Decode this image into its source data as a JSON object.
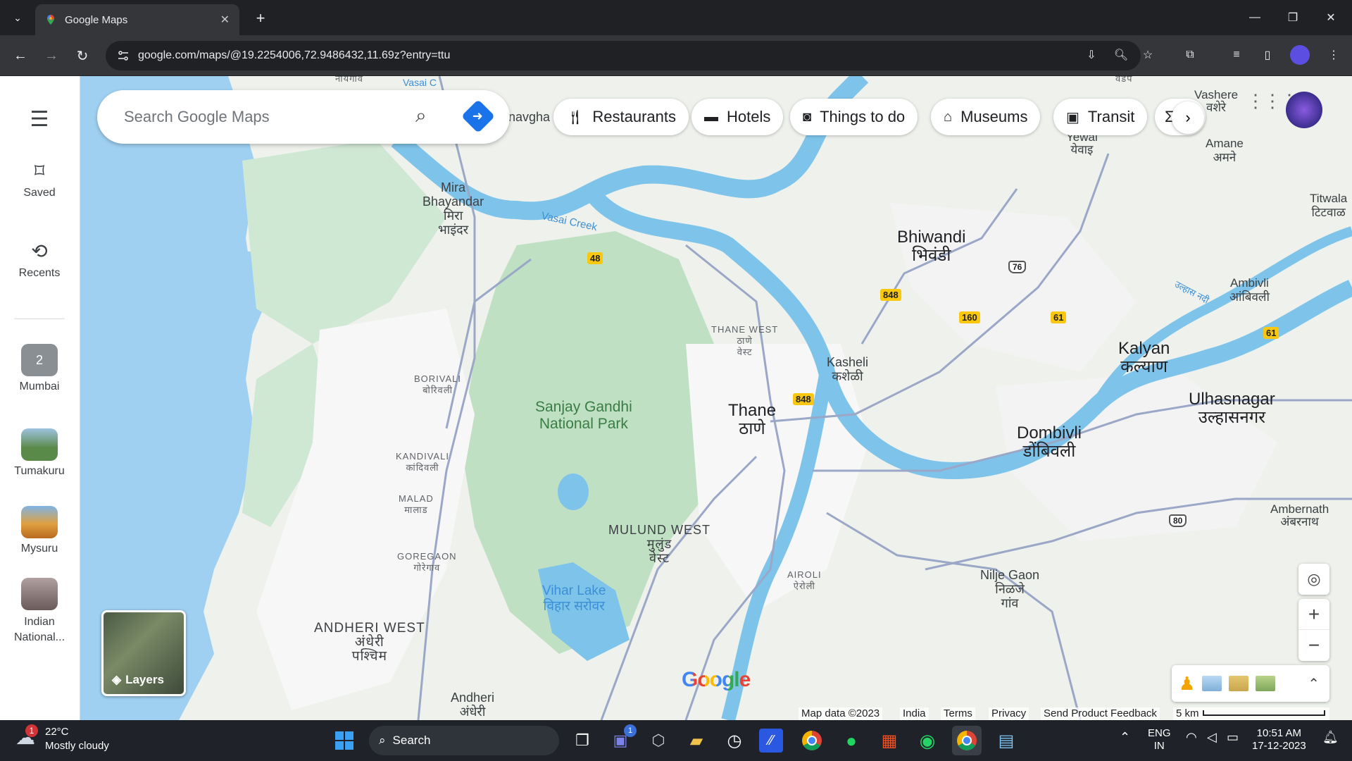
{
  "browser": {
    "tab_title": "Google Maps",
    "url": "google.com/maps/@19.2254006,72.9486432,11.69z?entry=ttu"
  },
  "sidebar": {
    "menu_icon": "hamburger-icon",
    "saved_label": "Saved",
    "recents_label": "Recents",
    "collections": [
      {
        "label": "Mumbai",
        "badge": "2"
      },
      {
        "label": "Tumakuru"
      },
      {
        "label": "Mysuru"
      },
      {
        "label": "Indian National..."
      }
    ]
  },
  "search": {
    "placeholder": "Search Google Maps"
  },
  "chips": [
    "Restaurants",
    "Hotels",
    "Things to do",
    "Museums",
    "Transit"
  ],
  "map": {
    "layers_label": "Layers",
    "logo": "Google",
    "attribution": {
      "data": "Map data ©2023",
      "country": "India",
      "terms": "Terms",
      "privacy": "Privacy",
      "feedback": "Send Product Feedback",
      "scale": "5 km"
    },
    "labels": {
      "naygaon": "नायगाव",
      "vasai": "Vasai C",
      "navghar": "navgha",
      "vadap": "वडप",
      "vashere": "Vashere",
      "vashere_mr": "वशेरे",
      "mira": "Mira",
      "bhayandar": "Bhayandar",
      "mira_mr1": "मिरा",
      "mira_mr2": "भाइंदर",
      "vasai_creek": "Vasai Creek",
      "bhiwandi": "Bhiwandi",
      "bhiwandi_mr": "भिवंडी",
      "yewai": "Yewai",
      "yewai_mr": "येवाइ",
      "amane": "Amane",
      "amane_mr": "अमने",
      "titwala": "Titwala",
      "titwala_mr": "टिटवाळ",
      "ambivli": "Ambivli",
      "ambivli_mr": "आंबिवली",
      "ulhas_nadi": "उल्हास नदी",
      "thane_west": "THANE WEST",
      "thane_west_mr1": "ठाणे",
      "thane_west_mr2": "वेस्ट",
      "kasheli": "Kasheli",
      "kasheli_mr": "कशेळी",
      "kalyan": "Kalyan",
      "kalyan_mr": "कल्याण",
      "ulhasnagar": "Ulhasnagar",
      "ulhasnagar_mr": "उल्हासनगर",
      "borivali": "BORIVALI",
      "borivali_mr": "बोरिवली",
      "sgnp1": "Sanjay Gandhi",
      "sgnp2": "National Park",
      "thane": "Thane",
      "thane_mr": "ठाणे",
      "dombivli": "Dombivli",
      "dombivli_mr": "डोंबिवली",
      "kandivali": "KANDIVALI",
      "kandivali_mr": "कांदिवली",
      "malad": "MALAD",
      "malad_mr": "मालाड",
      "mulund": "MULUND WEST",
      "mulund_mr1": "मुलुंड",
      "mulund_mr2": "वेस्ट",
      "ambernath": "Ambernath",
      "ambernath_mr": "अंबरनाथ",
      "goregaon": "GOREGAON",
      "goregaon_mr": "गोरेगाव",
      "airoli": "AIROLI",
      "airoli_mr": "ऐरोली",
      "nilje": "Nilje Gaon",
      "nilje_mr1": "निळजे",
      "nilje_mr2": "गांव",
      "vihar1": "Vihar Lake",
      "vihar2": "विहार सरोवर",
      "andheri_west": "ANDHERI WEST",
      "andheri_west_mr1": "अंधेरी",
      "andheri_west_mr2": "पश्चिम",
      "andheri": "Andheri",
      "andheri_mr": "अंधेरी"
    },
    "shields": {
      "s48": "48",
      "s848a": "848",
      "s848b": "848",
      "s160": "160",
      "s61a": "61",
      "s61b": "61",
      "nh76": "76",
      "nh80": "80"
    }
  },
  "taskbar": {
    "weather_badge": "1",
    "temperature": "22°C",
    "condition": "Mostly cloudy",
    "search_label": "Search",
    "chat_badge": "1",
    "lang1": "ENG",
    "lang2": "IN",
    "time": "10:51 AM",
    "date": "17-12-2023"
  }
}
